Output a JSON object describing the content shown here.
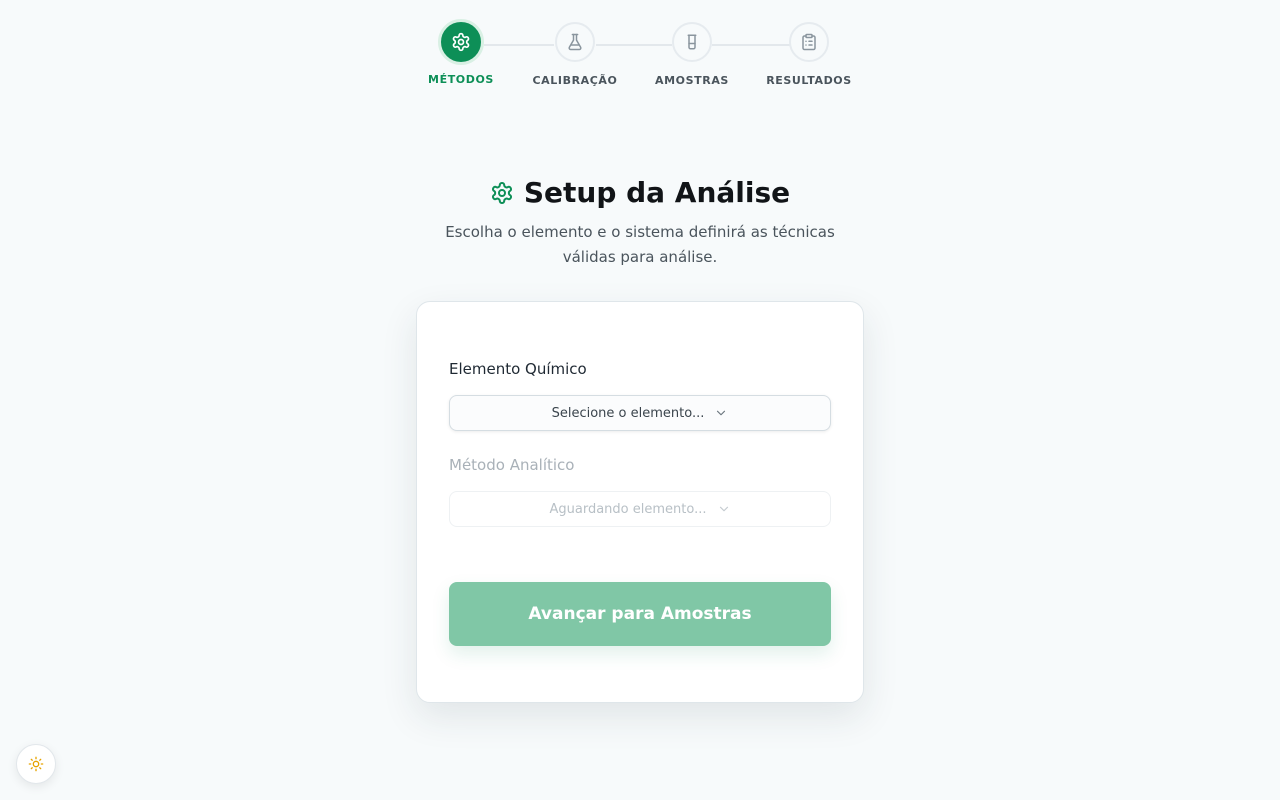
{
  "stepper": {
    "steps": [
      {
        "label": "MÉTODOS",
        "icon": "gear-icon",
        "active": true
      },
      {
        "label": "CALIBRAÇÃO",
        "icon": "flask-icon",
        "active": false
      },
      {
        "label": "AMOSTRAS",
        "icon": "test-tube-icon",
        "active": false
      },
      {
        "label": "RESULTADOS",
        "icon": "clipboard-list-icon",
        "active": false
      }
    ]
  },
  "header": {
    "icon": "gear-icon",
    "title": "Setup da Análise",
    "subtitle": "Escolha o elemento e o sistema definirá as técnicas válidas para análise."
  },
  "form": {
    "element_label": "Elemento Químico",
    "element_select_value": "Selecione o elemento...",
    "method_label": "Método Analítico",
    "method_select_value": "Aguardando elemento...",
    "method_disabled": true,
    "submit_label": "Avançar para Amostras",
    "submit_disabled": true
  },
  "theme_toggle": {
    "icon": "sun-icon"
  },
  "colors": {
    "accent": "#0d8f57",
    "accent_light": "#80c7a6",
    "background": "#f7fafb",
    "sun": "#e6a300"
  }
}
